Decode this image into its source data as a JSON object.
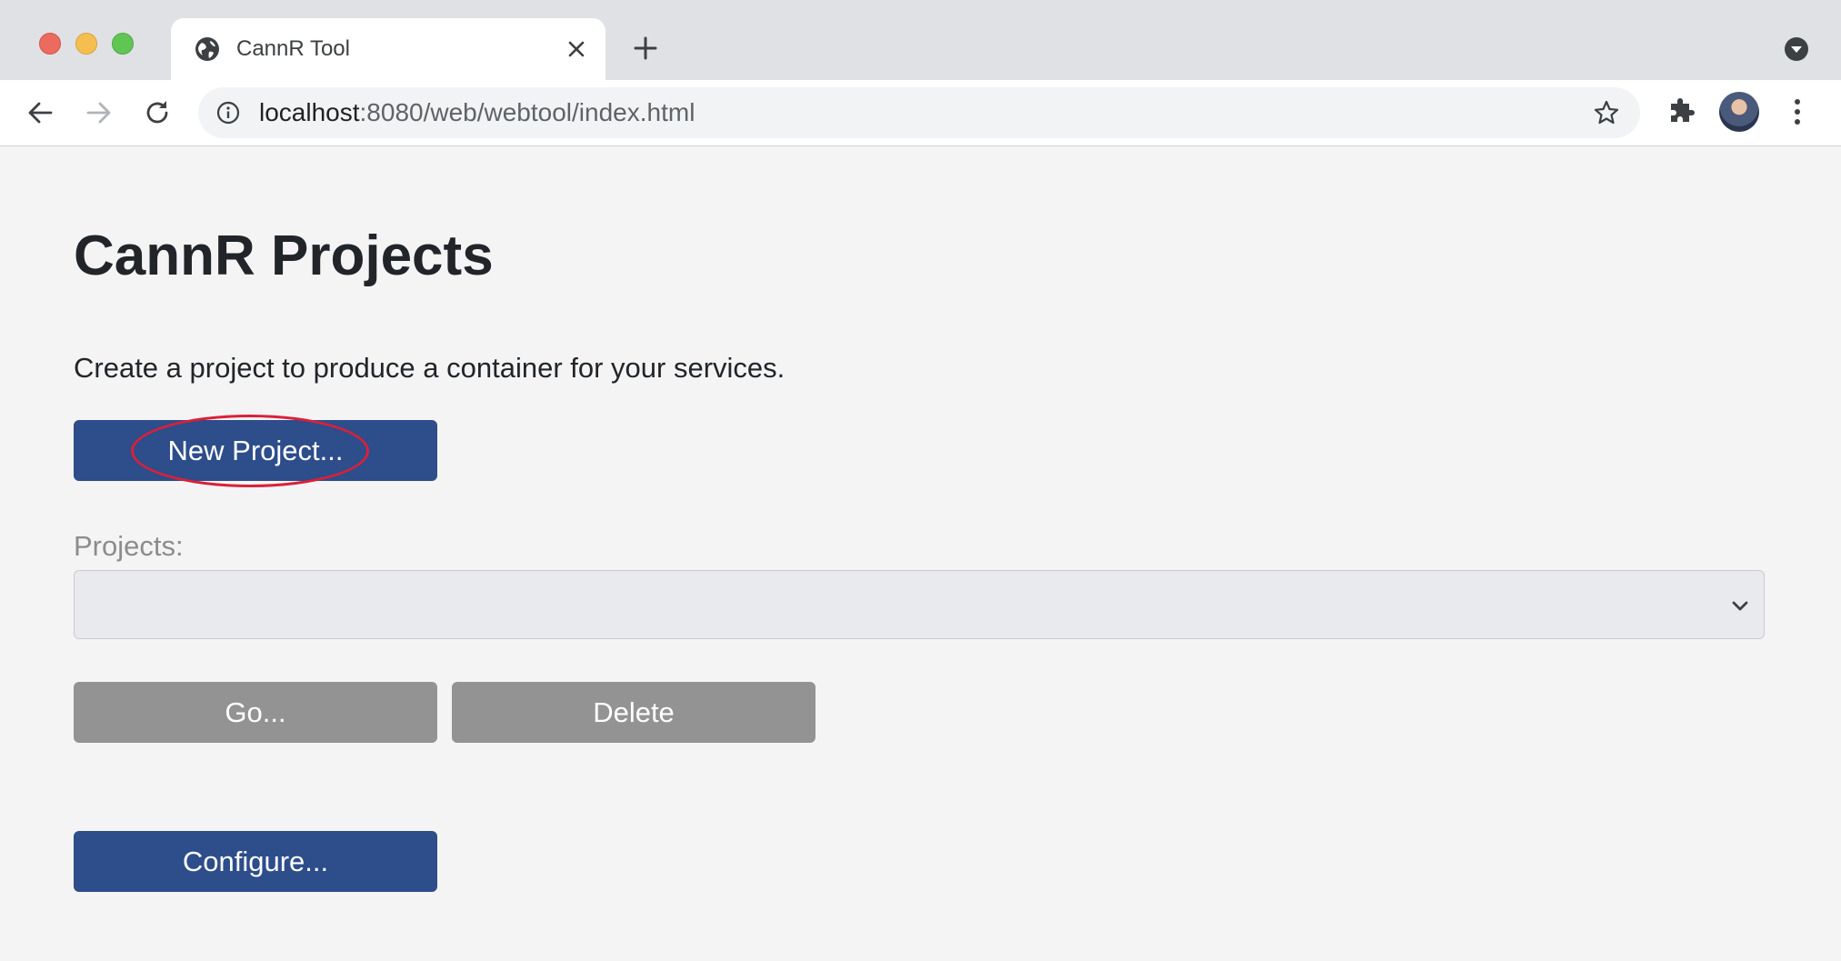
{
  "browser": {
    "tab": {
      "title": "CannR Tool",
      "icon": "globe-icon",
      "close_icon": "close-icon"
    },
    "new_tab_icon": "plus-icon",
    "tab_menu_icon": "chevron-down-circle-icon",
    "toolbar": {
      "back_icon": "arrow-left-icon",
      "forward_icon": "arrow-right-icon",
      "reload_icon": "reload-icon",
      "info_icon": "info-icon",
      "url_host": "localhost",
      "url_rest": ":8080/web/webtool/index.html",
      "bookmark_icon": "star-icon",
      "extensions_icon": "puzzle-icon",
      "profile_icon": "avatar",
      "menu_icon": "kebab-icon"
    }
  },
  "page": {
    "title": "CannR Projects",
    "intro": "Create a project to produce a container for your services.",
    "new_project_label": "New Project...",
    "projects_label": "Projects:",
    "projects_selected": "",
    "go_label": "Go...",
    "delete_label": "Delete",
    "configure_label": "Configure..."
  },
  "colors": {
    "primary_button": "#2d4d8b",
    "disabled_button": "#939393",
    "highlight": "#d9203a"
  }
}
